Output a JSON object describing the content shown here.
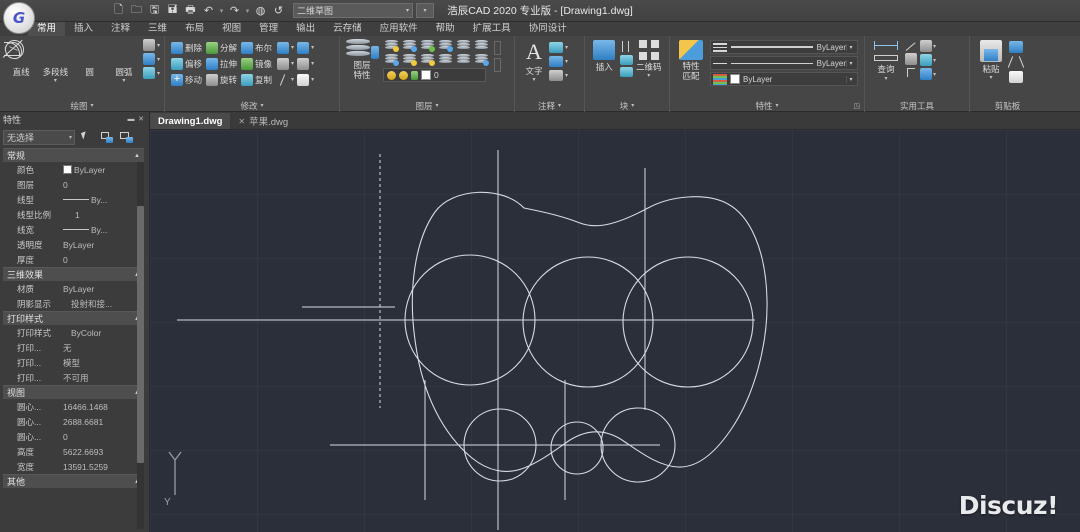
{
  "window": {
    "title": "浩辰CAD 2020 专业版 - [Drawing1.dwg]"
  },
  "quick_access": {
    "icons": [
      "new-icon",
      "open-icon",
      "save-icon",
      "save-as-icon",
      "plot-icon",
      "undo-icon",
      "redo-icon",
      "render-icon",
      "refresh-icon"
    ],
    "workspace_value": "二维草图",
    "workspace_arrow": "▾",
    "extra_arrow": "▾"
  },
  "ribbon_tabs": [
    {
      "label": "常用",
      "active": true
    },
    {
      "label": "插入",
      "active": false
    },
    {
      "label": "注释",
      "active": false
    },
    {
      "label": "三维",
      "active": false
    },
    {
      "label": "布局",
      "active": false
    },
    {
      "label": "视图",
      "active": false
    },
    {
      "label": "管理",
      "active": false
    },
    {
      "label": "输出",
      "active": false
    },
    {
      "label": "云存储",
      "active": false
    },
    {
      "label": "应用软件",
      "active": false
    },
    {
      "label": "帮助",
      "active": false
    },
    {
      "label": "扩展工具",
      "active": false
    },
    {
      "label": "协同设计",
      "active": false
    }
  ],
  "ribbon": {
    "draw": {
      "title": "绘图",
      "buttons": [
        {
          "label": "直线",
          "icon": "line-icon",
          "has_arrow": false
        },
        {
          "label": "多段线",
          "icon": "polyline-icon",
          "has_arrow": true
        },
        {
          "label": "圆",
          "icon": "circle-icon",
          "has_arrow": false
        },
        {
          "label": "圆弧",
          "icon": "arc-icon",
          "has_arrow": true
        }
      ],
      "extra_icons": [
        "hatch-icon",
        "ellipse-icon",
        "region-icon"
      ],
      "arrow": "▾"
    },
    "modify": {
      "title": "修改",
      "buttons": [
        {
          "label": "删除",
          "icon": "erase-icon"
        },
        {
          "label": "分解",
          "icon": "explode-icon"
        },
        {
          "label": "布尔",
          "icon": "boolean-icon"
        },
        {
          "label": "偏移",
          "icon": "offset-icon"
        },
        {
          "label": "拉伸",
          "icon": "stretch-icon"
        },
        {
          "label": "镜像",
          "icon": "mirror-icon"
        },
        {
          "label": "移动",
          "icon": "move-icon"
        },
        {
          "label": "旋转",
          "icon": "rotate-icon"
        },
        {
          "label": "复制",
          "icon": "copy-icon"
        }
      ],
      "arrow": "▾"
    },
    "layers": {
      "title": "图层",
      "big_label_line1": "图层",
      "big_label_line2": "特性",
      "layer_value": "0",
      "arrow": "▾"
    },
    "annotation": {
      "title": "注释",
      "text_label": "文字",
      "arrow": "▾"
    },
    "block": {
      "title": "块",
      "insert_label": "插入",
      "qrcode_label": "二维码",
      "arrow": "▾"
    },
    "properties": {
      "title": "特性",
      "match_label_line1": "特性",
      "match_label_line2": "匹配",
      "rows": [
        {
          "value": "ByLayer",
          "kind": "color"
        },
        {
          "value": "ByLayer",
          "kind": "linetype"
        },
        {
          "value": "ByLayer",
          "kind": "lineweight"
        }
      ],
      "arrow": "▾"
    },
    "utilities": {
      "title": "实用工具",
      "query_label": "查询",
      "arrow": "▾"
    },
    "clipboard": {
      "title": "剪贴板",
      "paste_label": "粘贴",
      "arrow": "▾"
    }
  },
  "doc_tabs": [
    {
      "label": "Drawing1.dwg",
      "active": true,
      "close": "✕"
    },
    {
      "label": "苹果.dwg",
      "active": false,
      "close": "✕"
    }
  ],
  "palette": {
    "title": "特性",
    "min_btn": "▬",
    "close_btn": "✕",
    "selection": "无选择",
    "selection_arrow": "▾",
    "header_icons": [
      "pick-icon",
      "quick-select-icon",
      "select-similar-icon"
    ],
    "groups": [
      {
        "name": "常规",
        "collapse": "▲",
        "rows": [
          {
            "key": "颜色",
            "value": "ByLayer",
            "swatch": true
          },
          {
            "key": "图层",
            "value": "0"
          },
          {
            "key": "线型",
            "value": "By...",
            "dash": true
          },
          {
            "key": "线型比例",
            "value": "1"
          },
          {
            "key": "线宽",
            "value": "By...",
            "dash": true
          },
          {
            "key": "透明度",
            "value": "ByLayer"
          },
          {
            "key": "厚度",
            "value": "0"
          }
        ]
      },
      {
        "name": "三维效果",
        "collapse": "▲",
        "rows": [
          {
            "key": "材质",
            "value": "ByLayer"
          },
          {
            "key": "阴影显示",
            "value": "投射和接..."
          }
        ]
      },
      {
        "name": "打印样式",
        "collapse": "▲",
        "rows": [
          {
            "key": "打印样式",
            "value": "ByColor"
          },
          {
            "key": "打印...",
            "value": "无"
          },
          {
            "key": "打印...",
            "value": "模型"
          },
          {
            "key": "打印...",
            "value": "不可用"
          }
        ]
      },
      {
        "name": "视图",
        "collapse": "▲",
        "rows": [
          {
            "key": "圆心...",
            "value": "16466.1468"
          },
          {
            "key": "圆心...",
            "value": "2688.6681"
          },
          {
            "key": "圆心...",
            "value": "0"
          },
          {
            "key": "高度",
            "value": "5622.6693"
          },
          {
            "key": "宽度",
            "value": "13591.5259"
          }
        ]
      },
      {
        "name": "其他",
        "collapse": "▲",
        "rows": []
      }
    ]
  },
  "canvas": {
    "background_color": "#2b2f3a",
    "grid_color": "#3a4150",
    "geometry_color": "#d7dbe2",
    "ucs_axis_label": "Y",
    "watermark": "Discuz!"
  }
}
